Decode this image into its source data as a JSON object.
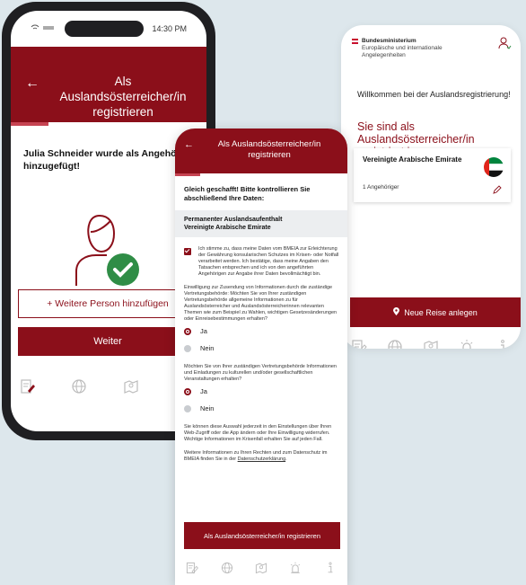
{
  "colors": {
    "primary": "#8b0f1a",
    "accent": "#c64452",
    "success": "#2f8d46",
    "background": "#dde7ec"
  },
  "phone1": {
    "status_time": "14:30 PM",
    "header_title": "Als Auslandsösterreicher/in registrieren",
    "back_icon": "arrow-left-icon",
    "message": "Julia Schneider wurde als Angehörige hinzugefügt!",
    "add_person_label": "+ Weitere Person hinzufügen",
    "continue_label": "Weiter"
  },
  "phone2": {
    "header_title": "Als Auslandsösterreicher/in registrieren",
    "intro": "Gleich geschafft! Bitte kontrollieren Sie abschließend Ihre Daten:",
    "summary_line1": "Permanenter Auslandsaufenthalt",
    "summary_line2": "Vereinigte Arabische Emirate",
    "consent_text": "Ich stimme zu, dass meine Daten vom BMEIA zur Erleichterung der Gewährung konsularischen Schutzes im Krisen- oder Notfall verarbeitet werden. Ich bestätige, dass meine Angaben den Tatsachen entsprechen und ich von den angeführten Angehörigen zur Angabe ihrer Daten bevollmächtigt bin.",
    "question1": "Einwilligung zur Zusendung von Informationen durch die zuständige Vertretungsbehörde: Möchten Sie von Ihrer zuständigen Vertretungsbehörde allgemeine Informationen zu für Auslandsösterreicher und Auslandsösterreicherinnen relevanten Themen wie zum Beispiel zu Wahlen, wichtigen Gesetzesänderungen oder Einreisebestimmungen erhalten?",
    "q1_yes": "Ja",
    "q1_no": "Nein",
    "question2": "Möchten Sie von Ihrer zuständigen Vertretungsbehörde Informationen und Einladungen zu kulturellen und/oder gesellschaftlichen Veranstaltungen erhalten?",
    "q2_yes": "Ja",
    "q2_no": "Nein",
    "note1": "Sie können diese Auswahl jederzeit in den Einstellungen über Ihren Web-Zugriff oder die App ändern oder Ihre Einwilligung widerrufen. Wichtige Informationen im Krisenfall erhalten Sie auf jeden Fall.",
    "note2_prefix": "Weitere Informationen zu Ihren Rechten und zum Datenschutz im BMEIA finden Sie in der",
    "note2_link": "Datenschutzerklärung",
    "note2_suffix": ".",
    "submit_label": "Als Auslandsösterreicher/in registrieren"
  },
  "phone3": {
    "brand_line1": "Bundesministerium",
    "brand_line2": "Europäische und internationale",
    "brand_line3": "Angelegenheiten",
    "welcome": "Willkommen bei der Auslandsregistrierung!",
    "heading": "Sie sind als Auslandsösterreicher/in registriert in:",
    "country_name": "Vereinigte Arabische Emirate",
    "dependents": "1 Angehöriger",
    "new_trip_label": "Neue Reise anlegen"
  },
  "tabs": [
    "register-icon",
    "globe-icon",
    "map-icon",
    "alarm-icon",
    "info-icon"
  ]
}
